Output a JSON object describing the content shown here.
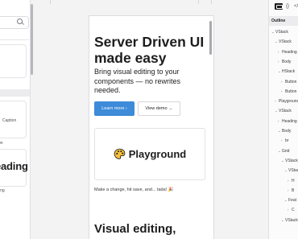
{
  "left_panel": {
    "caption": "Caption",
    "on_fragment": "on",
    "heading_fragment": "eading",
    "ing_fragment": "ing"
  },
  "canvas": {
    "hero_title": "Server Driven UI made easy",
    "hero_subtitle": "Bring visual editing to your components — no rewrites needed.",
    "primary_button": "Learn more ›",
    "secondary_button": "View demo →",
    "playground_title": "Playground",
    "playground_icon": "palette-icon",
    "tip": "Make a change, hit save, and... tada! 🎉",
    "section_title": "Visual editing,"
  },
  "right_panel": {
    "tab_code": "{}",
    "tab_more": "</",
    "header": "Outline",
    "tree": [
      {
        "label": "VStack",
        "expanded": true
      },
      {
        "label": "VStack",
        "expanded": true
      },
      {
        "label": "Heading",
        "expanded": false
      },
      {
        "label": "Body",
        "expanded": false
      },
      {
        "label": "HStack",
        "expanded": true
      },
      {
        "label": "Button",
        "expanded": false
      },
      {
        "label": "Button",
        "expanded": false
      },
      {
        "label": "Playground",
        "expanded": false
      },
      {
        "label": "VStack",
        "expanded": true
      },
      {
        "label": "Heading",
        "expanded": false
      },
      {
        "label": "Body",
        "expanded": true
      },
      {
        "label": "br",
        "expanded": false
      },
      {
        "label": "Grid",
        "expanded": true
      },
      {
        "label": "VStack",
        "expanded": true
      },
      {
        "label": "VStack",
        "expanded": true
      },
      {
        "label": "H",
        "expanded": false
      },
      {
        "label": "B",
        "expanded": false
      },
      {
        "label": "Feat",
        "expanded": true
      },
      {
        "label": "C",
        "expanded": false
      },
      {
        "label": "VStack",
        "expanded": true
      }
    ]
  },
  "colors": {
    "accent": "#3d8bd9",
    "canvas_bg": "#f3f3f4",
    "panel_bg": "#ffffff"
  }
}
